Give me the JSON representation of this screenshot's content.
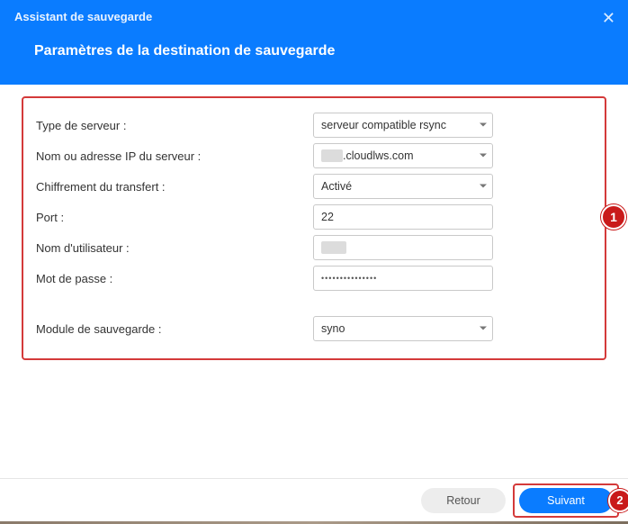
{
  "header": {
    "title": "Assistant de sauvegarde",
    "subtitle": "Paramètres de la destination de sauvegarde"
  },
  "form": {
    "server_type": {
      "label": "Type de serveur :",
      "value": "serveur compatible rsync"
    },
    "server_name": {
      "label": "Nom ou adresse IP du serveur :",
      "value_suffix": ".cloudlws.com"
    },
    "encryption": {
      "label": "Chiffrement du transfert :",
      "value": "Activé"
    },
    "port": {
      "label": "Port :",
      "value": "22"
    },
    "username": {
      "label": "Nom d'utilisateur :"
    },
    "password": {
      "label": "Mot de passe :",
      "value": "•••••••••••••••"
    },
    "module": {
      "label": "Module de sauvegarde :",
      "value": "syno"
    }
  },
  "badges": {
    "one": "1",
    "two": "2"
  },
  "footer": {
    "back": "Retour",
    "next": "Suivant"
  }
}
